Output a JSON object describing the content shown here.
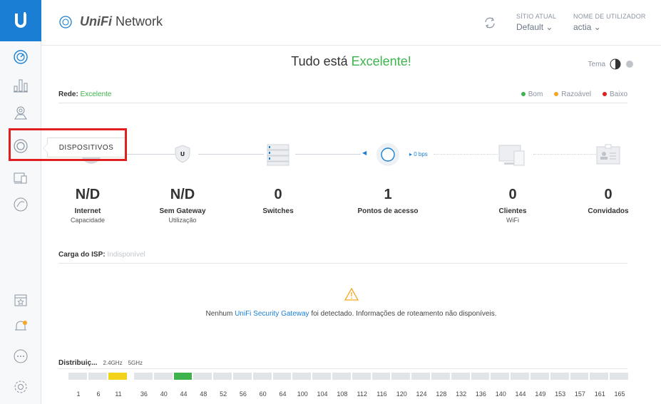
{
  "app": {
    "brand_prefix": "UniFi",
    "brand_suffix": " Network"
  },
  "header": {
    "site_label": "SÍTIO ATUAL",
    "site_value": "Default",
    "user_label": "NOME DE UTILIZADOR",
    "user_value": "actia"
  },
  "status": {
    "title_prefix": "Tudo está ",
    "title_highlight": "Excelente!",
    "theme_label": "Tema"
  },
  "network": {
    "label": "Rede:",
    "value": "Excelente",
    "legend": [
      {
        "label": "Bom",
        "color": "#3cb44b"
      },
      {
        "label": "Razoável",
        "color": "#f5a623"
      },
      {
        "label": "Baixo",
        "color": "#e02020"
      }
    ]
  },
  "tooltip": {
    "label": "DISPOSITIVOS"
  },
  "topology": {
    "ap_rate": "▸ 0 bps",
    "devices": [
      {
        "value": "N/D",
        "label": "Internet",
        "sub": "Capacidade"
      },
      {
        "value": "N/D",
        "label": "Sem Gateway",
        "sub": "Utilização"
      },
      {
        "value": "0",
        "label": "Switches",
        "sub": ""
      },
      {
        "value": "1",
        "label": "Pontos de acesso",
        "sub": ""
      },
      {
        "value": "0",
        "label": "Clientes",
        "sub": "WiFi"
      },
      {
        "value": "0",
        "label": "Convidados",
        "sub": ""
      }
    ]
  },
  "isp": {
    "label": "Carga do ISP:",
    "value": "Indisponível"
  },
  "warning": {
    "prefix": "Nenhum ",
    "link": "UniFi Security Gateway",
    "suffix": " foi detectado. Informações de roteamento não disponíveis."
  },
  "channels": {
    "label": "Distribuiç...",
    "band_24": "2.4GHz",
    "band_5": "5GHz",
    "channels_24": [
      "1",
      "6",
      "11"
    ],
    "channels_5": [
      "36",
      "40",
      "44",
      "48",
      "52",
      "56",
      "60",
      "64",
      "100",
      "104",
      "108",
      "112",
      "116",
      "120",
      "124",
      "128",
      "132",
      "136",
      "140",
      "144",
      "149",
      "153",
      "157",
      "161",
      "165"
    ],
    "active_24": "11",
    "active_5": "44",
    "active_24_color": "#f2d21b",
    "active_5_color": "#3cb44b"
  },
  "colors": {
    "accent": "#1a7fd4",
    "good": "#3cb44b",
    "warn": "#f5a623",
    "highlight_box": "#e02020"
  }
}
